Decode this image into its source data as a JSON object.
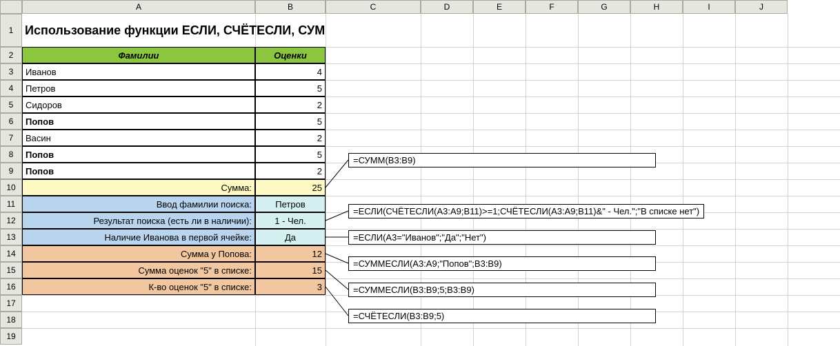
{
  "columns": [
    "A",
    "B",
    "C",
    "D",
    "E",
    "F",
    "G",
    "H",
    "I",
    "J"
  ],
  "row_numbers": [
    "1",
    "2",
    "3",
    "4",
    "5",
    "6",
    "7",
    "8",
    "9",
    "10",
    "11",
    "12",
    "13",
    "14",
    "15",
    "16",
    "17",
    "18",
    "19"
  ],
  "title": "Использование функции ЕСЛИ, СЧЁТЕСЛИ, СУММЕСЛИ",
  "header": {
    "a": "Фамилии",
    "b": "Оценки"
  },
  "rows": [
    {
      "name": "Иванов",
      "val": "4",
      "bold": false
    },
    {
      "name": "Петров",
      "val": "5",
      "bold": false
    },
    {
      "name": "Сидоров",
      "val": "2",
      "bold": false
    },
    {
      "name": "Попов",
      "val": "5",
      "bold": true
    },
    {
      "name": "Васин",
      "val": "2",
      "bold": false
    },
    {
      "name": "Попов",
      "val": "5",
      "bold": true
    },
    {
      "name": "Попов",
      "val": "2",
      "bold": true
    }
  ],
  "sum": {
    "label": "Сумма:",
    "val": "25"
  },
  "search_in": {
    "label": "Ввод фамилии поиска:",
    "val": "Петров"
  },
  "search_out": {
    "label": "Результат поиска (есть ли в наличии):",
    "val": "1 - Чел."
  },
  "ivanov": {
    "label": "Наличие Иванова в первой ячейке:",
    "val": "Да"
  },
  "popov": {
    "label": "Сумма у Попова:",
    "val": "12"
  },
  "sum5": {
    "label": "Сумма оценок \"5\" в списке:",
    "val": "15"
  },
  "cnt5": {
    "label": "К-во оценок \"5\" в списке:",
    "val": "3"
  },
  "formulas": {
    "f1": "=СУММ(B3:B9)",
    "f2": "=ЕСЛИ(СЧЁТЕСЛИ(A3:A9;B11)>=1;СЧЁТЕСЛИ(A3:A9;B11)&\" - Чел.\";\"В списке нет\")",
    "f3": "=ЕСЛИ(A3=\"Иванов\";\"Да\";\"Нет\")",
    "f4": "=СУММЕСЛИ(A3:A9;\"Попов\";B3:B9)",
    "f5": "=СУММЕСЛИ(B3:B9;5;B3:B9)",
    "f6": "=СЧЁТЕСЛИ(B3:B9;5)"
  }
}
